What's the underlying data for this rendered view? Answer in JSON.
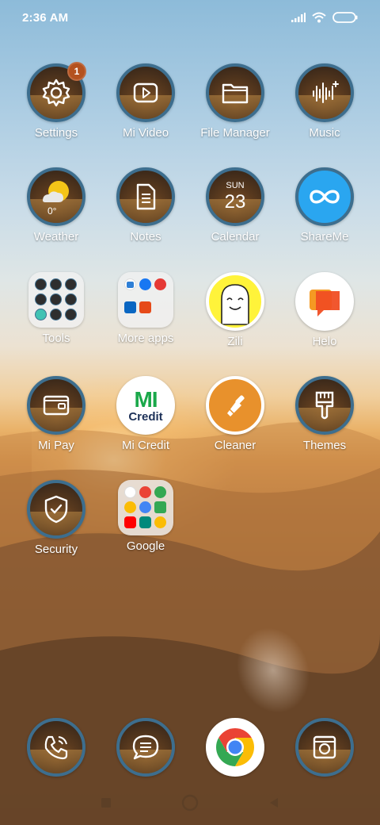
{
  "status_bar": {
    "time": "2:36 AM",
    "icons": [
      "signal-icon",
      "wifi-icon",
      "battery-icon"
    ]
  },
  "badges": {
    "settings": "1"
  },
  "apps": {
    "settings": "Settings",
    "mi_video": "Mi Video",
    "file_manager": "File Manager",
    "music": "Music",
    "weather": "Weather",
    "notes": "Notes",
    "calendar": "Calendar",
    "shareme": "ShareMe",
    "tools": "Tools",
    "more_apps": "More apps",
    "zili": "Zili",
    "helo": "Helo",
    "mi_pay": "Mi Pay",
    "mi_credit": "Mi Credit",
    "cleaner": "Cleaner",
    "themes": "Themes",
    "security": "Security",
    "google": "Google"
  },
  "weather_icon": {
    "temperature": "0°"
  },
  "calendar_icon": {
    "day": "SUN",
    "date": "23"
  },
  "mi_credit_icon": {
    "logo_text": "Credit"
  },
  "dock": [
    "phone-icon",
    "messages-icon",
    "chrome-icon",
    "camera-icon"
  ],
  "colors": {
    "icon_ring": "#3d6e8e",
    "badge": "#b4521f",
    "shareme_bg": "#2aa6f0",
    "cleaner_bg": "#e8912c",
    "zili_bg": "#fff33a",
    "helo_orange": "#f26a1d"
  }
}
